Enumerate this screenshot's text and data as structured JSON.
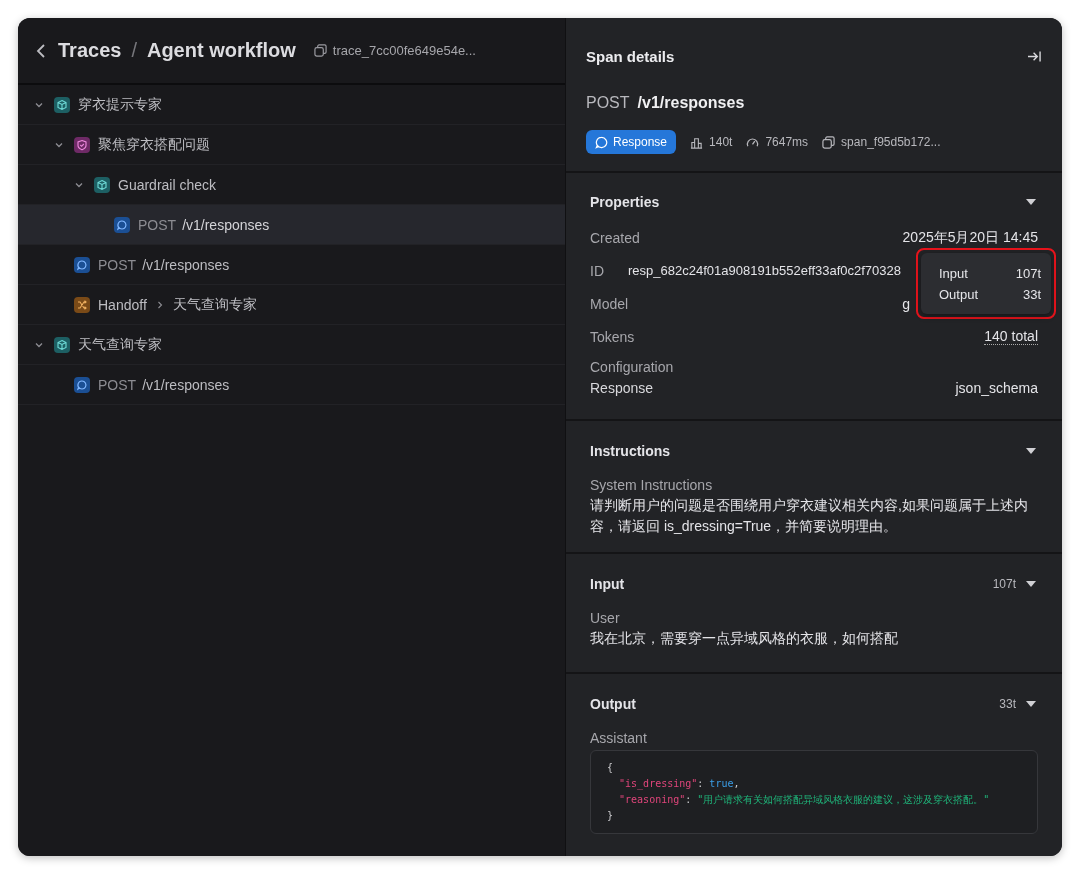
{
  "breadcrumb": [
    {
      "label": "Traces"
    },
    {
      "label": "Agent workflow"
    }
  ],
  "breadcrumb_separator": "/",
  "trace_id": "trace_7cc00fe649e54e...",
  "tree": [
    {
      "kind": "agent",
      "label": "穿衣提示专家",
      "expanded": true,
      "selected": false,
      "children": [
        {
          "kind": "guardrail",
          "label": "聚焦穿衣搭配问题",
          "expanded": true,
          "selected": false,
          "children": [
            {
              "kind": "agent",
              "label": "Guardrail check",
              "expanded": true,
              "selected": false,
              "children": [
                {
                  "kind": "response",
                  "method": "POST",
                  "path": "/v1/responses",
                  "selected": true
                }
              ]
            }
          ]
        },
        {
          "kind": "response",
          "method": "POST",
          "path": "/v1/responses",
          "selected": false
        },
        {
          "kind": "handoff",
          "label": "Handoff",
          "target": "天气查询专家",
          "selected": false
        }
      ]
    },
    {
      "kind": "agent",
      "label": "天气查询专家",
      "expanded": true,
      "selected": false,
      "children": [
        {
          "kind": "response",
          "method": "POST",
          "path": "/v1/responses",
          "selected": false
        }
      ]
    }
  ],
  "details": {
    "title": "Span details",
    "method": "POST",
    "path": "/v1/responses",
    "badge": "Response",
    "tokens": "140t",
    "duration": "7647ms",
    "span_id": "span_f95d5b172..."
  },
  "properties": {
    "title": "Properties",
    "expanded": true,
    "rows": [
      {
        "label": "Created",
        "value": "2025年5月20日 14:45",
        "kind": "right"
      },
      {
        "label": "ID",
        "value": "resp_682c24f01a908191b552eff33af0c2f70328",
        "kind": "inline"
      },
      {
        "label": "Model",
        "value": "g",
        "kind": "covered"
      },
      {
        "label": "Tokens",
        "value": "140 total",
        "kind": "underlined"
      }
    ],
    "config_title": "Configuration",
    "config_rows": [
      {
        "label": "Response",
        "value": "json_schema"
      }
    ]
  },
  "tooltip": {
    "highlighted": true,
    "rows": [
      {
        "label": "Input",
        "value": "107t"
      },
      {
        "label": "Output",
        "value": "33t"
      }
    ]
  },
  "instructions": {
    "title": "Instructions",
    "expanded": true,
    "role": "System Instructions",
    "text": "请判断用户的问题是否围绕用户穿衣建议相关内容,如果问题属于上述内容，请返回 is_dressing=True，并简要说明理由。"
  },
  "input": {
    "title": "Input",
    "expanded": true,
    "count": "107t",
    "role": "User",
    "text": "我在北京，需要穿一点异域风格的衣服，如何搭配"
  },
  "output": {
    "title": "Output",
    "expanded": true,
    "count": "33t",
    "role": "Assistant",
    "code": [
      [
        {
          "kind": "punct",
          "text": "{"
        }
      ],
      [
        {
          "kind": "key",
          "text": "  \"is_dressing\""
        },
        {
          "kind": "punct",
          "text": ": "
        },
        {
          "kind": "bool",
          "text": "true"
        },
        {
          "kind": "punct",
          "text": ","
        }
      ],
      [
        {
          "kind": "key",
          "text": "  \"reasoning\""
        },
        {
          "kind": "punct",
          "text": ": "
        },
        {
          "kind": "string",
          "text": "\"用户请求有关如何搭配异域风格衣服的建议，这涉及穿衣搭配。\""
        }
      ],
      [
        {
          "kind": "punct",
          "text": "}"
        }
      ]
    ]
  }
}
